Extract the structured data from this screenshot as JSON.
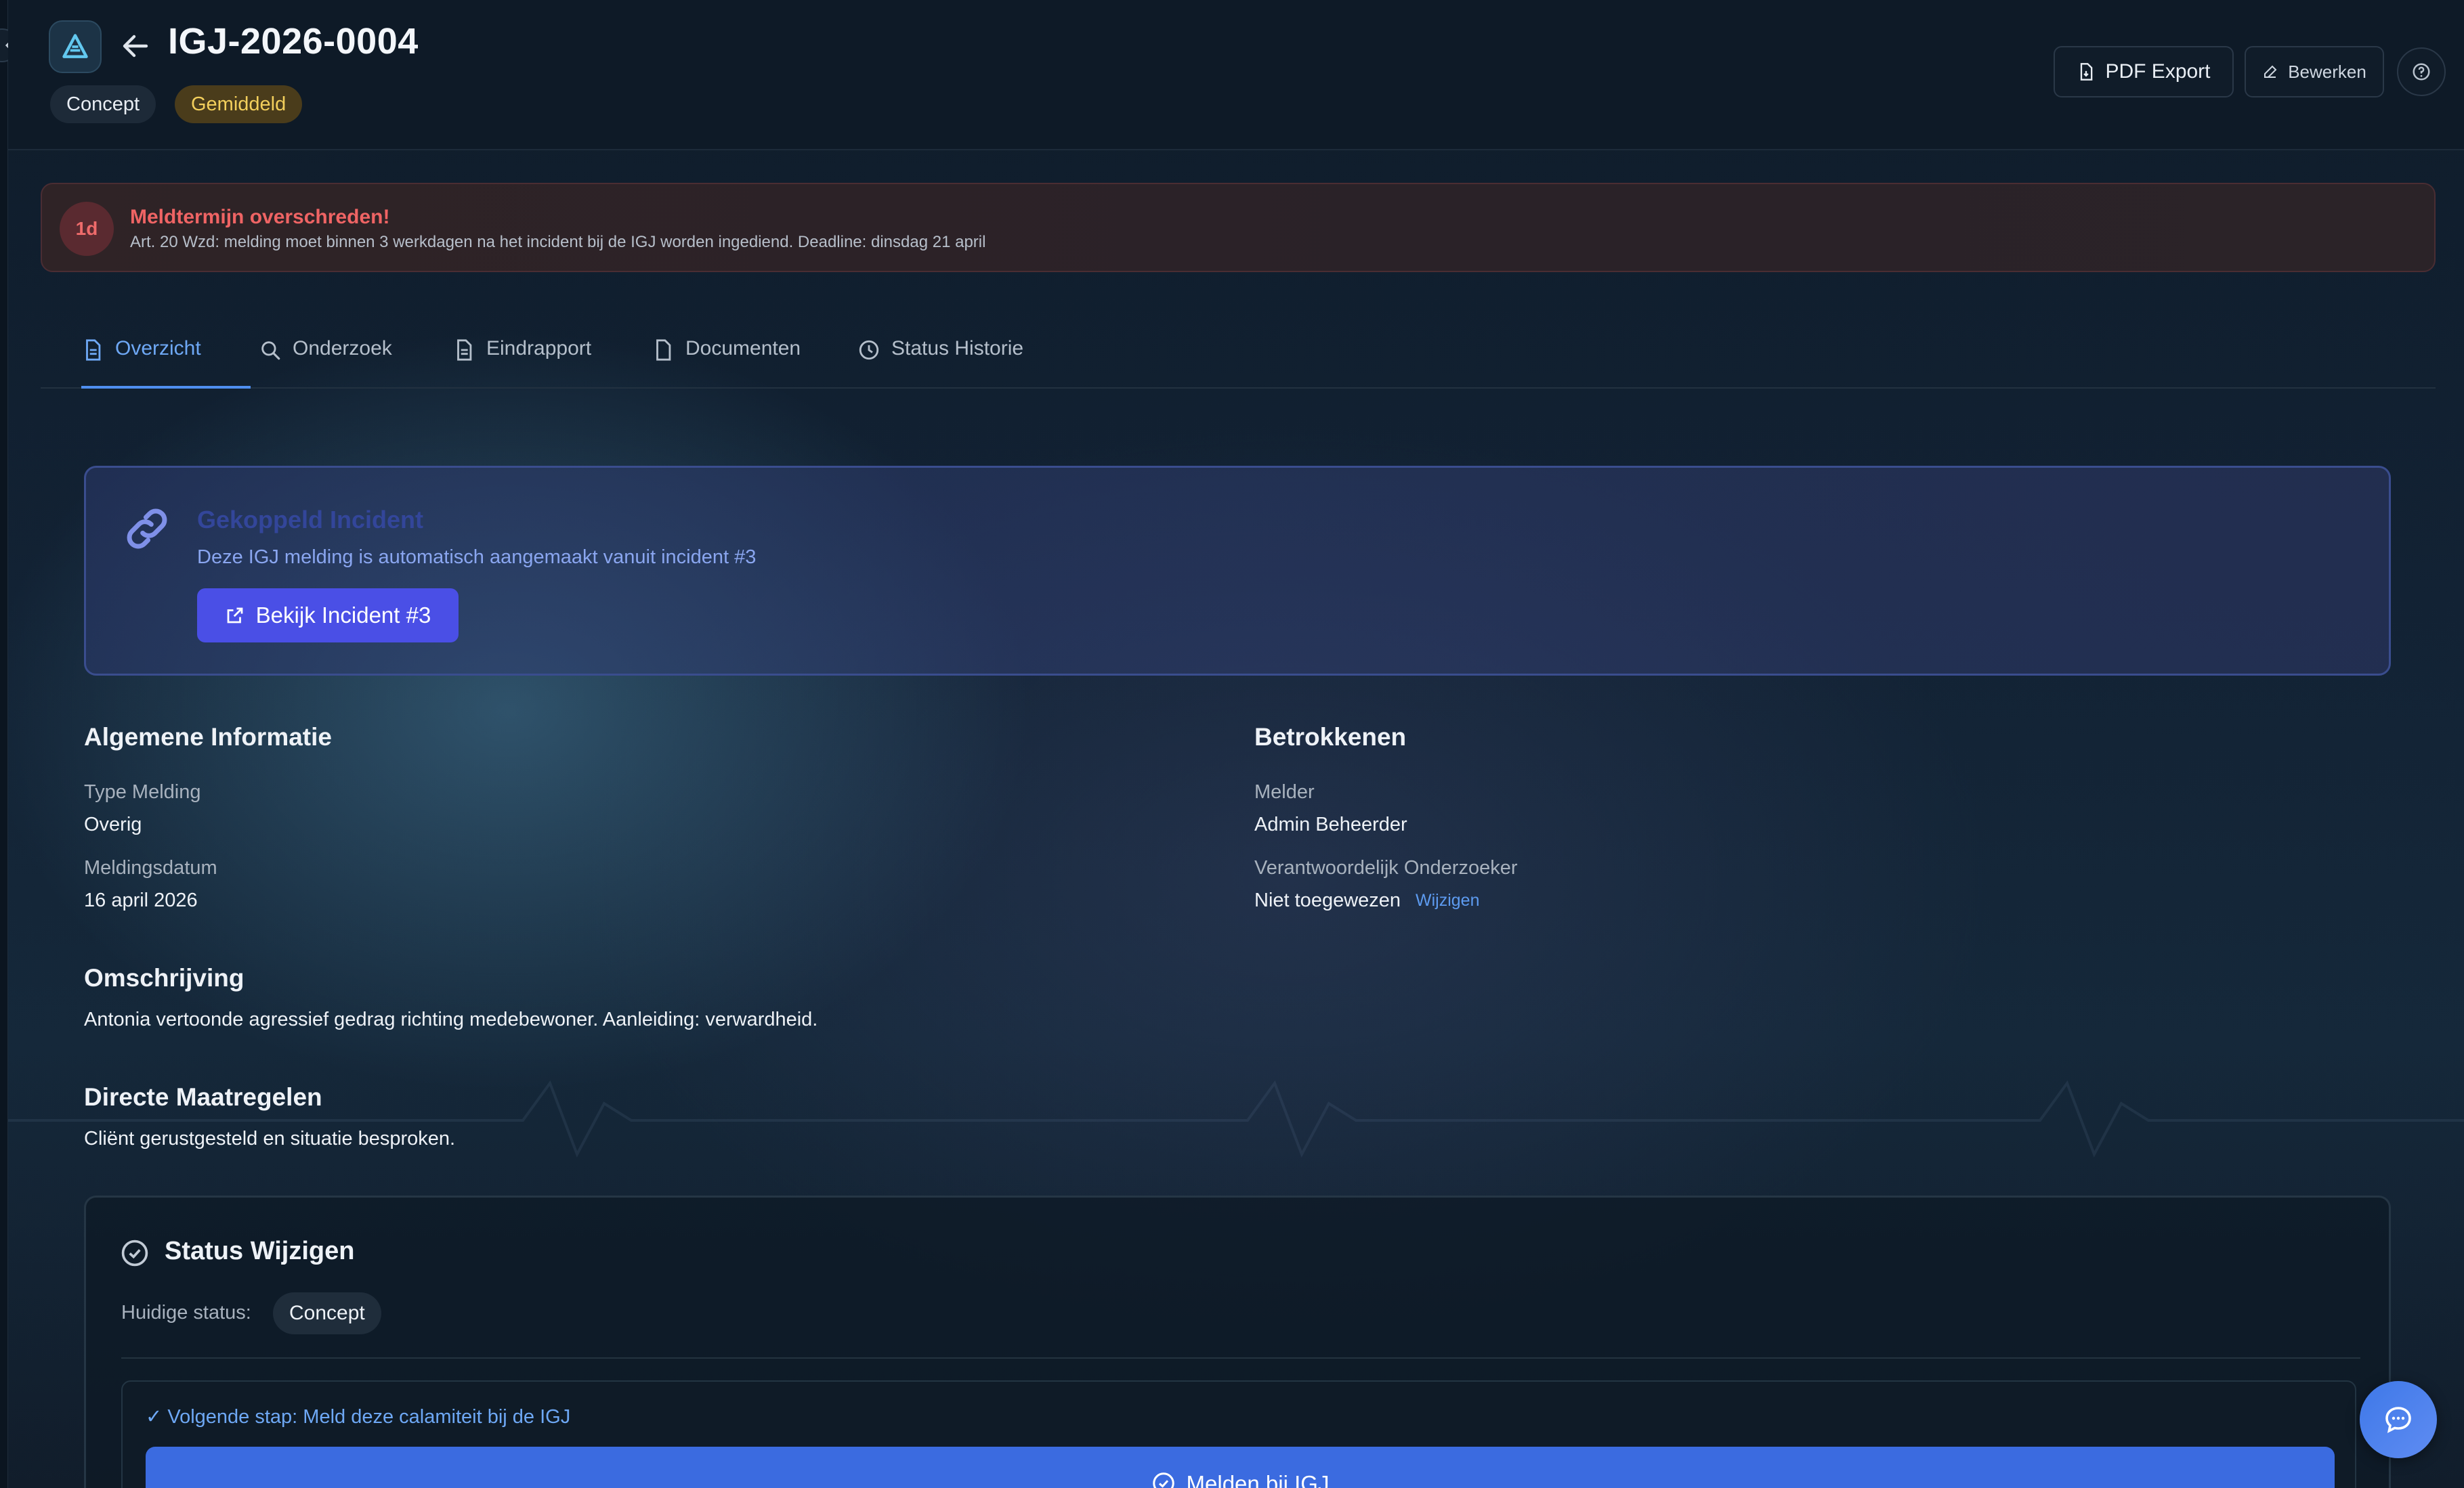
{
  "header": {
    "title": "IGJ-2026-0004",
    "badges": [
      "Concept",
      "Gemiddeld"
    ],
    "pdf_export_label": "PDF Export",
    "edit_label": "Bewerken"
  },
  "alert": {
    "days": "1d",
    "title": "Meldtermijn overschreden!",
    "text": "Art. 20 Wzd: melding moet binnen 3 werkdagen na het incident bij de IGJ worden ingediend. Deadline: dinsdag 21 april"
  },
  "tabs": [
    {
      "label": "Overzicht",
      "icon": "document-icon",
      "active": true
    },
    {
      "label": "Onderzoek",
      "icon": "search-icon",
      "active": false
    },
    {
      "label": "Eindrapport",
      "icon": "document-icon",
      "active": false
    },
    {
      "label": "Documenten",
      "icon": "file-icon",
      "active": false
    },
    {
      "label": "Status Historie",
      "icon": "clock-icon",
      "active": false
    }
  ],
  "linked": {
    "title": "Gekoppeld Incident",
    "desc": "Deze IGJ melding is automatisch aangemaakt vanuit incident #3",
    "button": "Bekijk Incident #3"
  },
  "general": {
    "heading": "Algemene Informatie",
    "type_label": "Type Melding",
    "type_value": "Overig",
    "date_label": "Meldingsdatum",
    "date_value": "16 april 2026"
  },
  "involved": {
    "heading": "Betrokkenen",
    "reporter_label": "Melder",
    "reporter_value": "Admin Beheerder",
    "investigator_label": "Verantwoordelijk Onderzoeker",
    "investigator_value": "Niet toegewezen",
    "change_link": "Wijzigen"
  },
  "description": {
    "heading": "Omschrijving",
    "text": "Antonia vertoonde agressief gedrag richting medebewoner. Aanleiding: verwardheid."
  },
  "measures": {
    "heading": "Directe Maatregelen",
    "text": "Cliënt gerustgesteld en situatie besproken."
  },
  "status": {
    "heading": "Status Wijzigen",
    "current_label": "Huidige status:",
    "current_value": "Concept",
    "next_step": "✓ Volgende stap: Meld deze calamiteit bij de IGJ",
    "action_button": "Melden bij IGJ"
  },
  "colors": {
    "accent": "#4f8ff0",
    "alert": "#ef6464",
    "badge_gemiddeld": "#f3cf5c",
    "primary_button": "#4a4fe6",
    "report_button": "#3b6be0"
  }
}
